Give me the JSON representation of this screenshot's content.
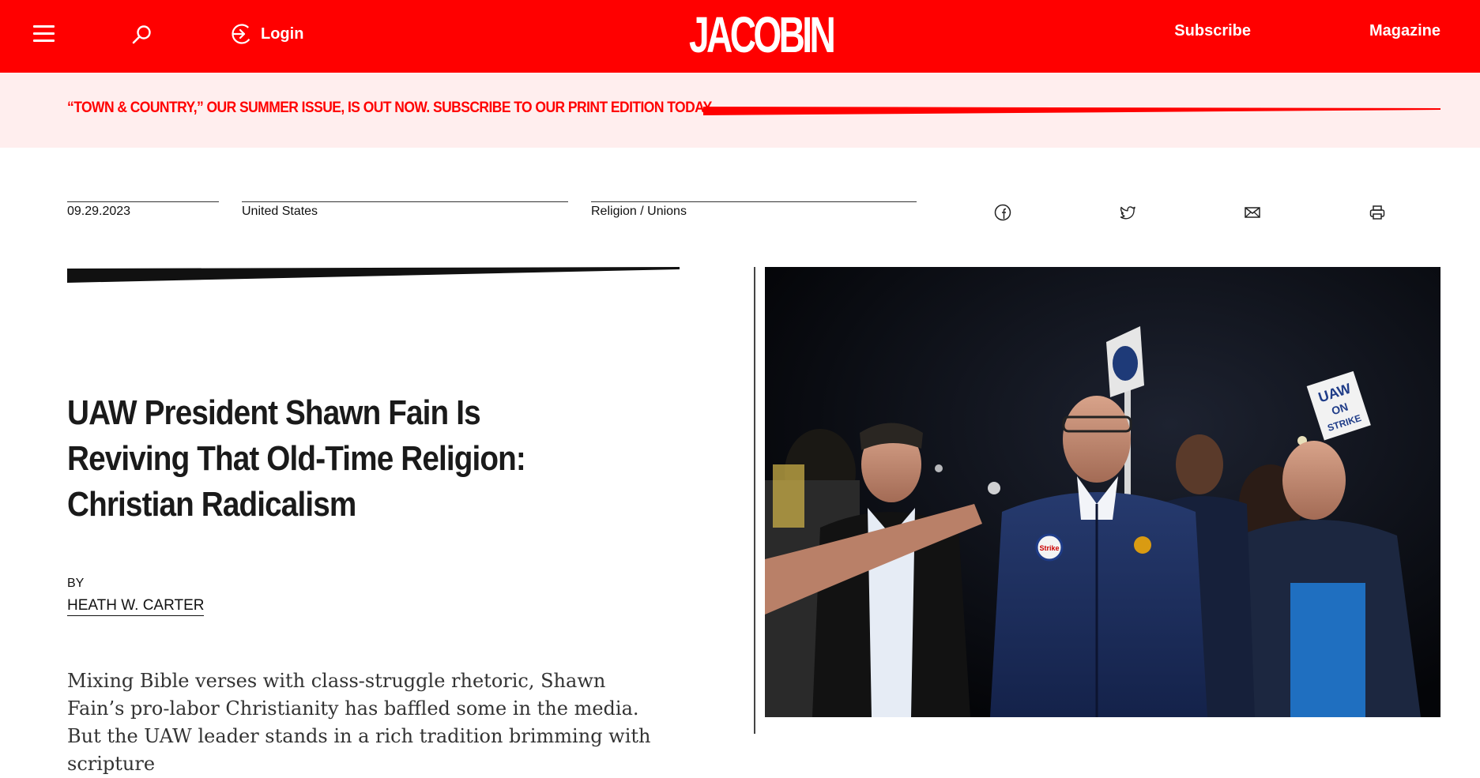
{
  "header": {
    "menu_icon": "hamburger-icon",
    "search_icon": "search-icon",
    "login_icon": "login-arrow-icon",
    "login_label": "Login",
    "logo": "JACOBIN",
    "subscribe_label": "Subscribe",
    "magazine_label": "Magazine",
    "brand_color": "#ff0000"
  },
  "promo": {
    "text": "“TOWN & COUNTRY,” OUR SUMMER ISSUE, IS OUT NOW. SUBSCRIBE TO OUR PRINT EDITION TODAY.",
    "background": "#ffeeee"
  },
  "meta": {
    "date": "09.29.2023",
    "region": "United States",
    "topics": "Religion / Unions"
  },
  "share": {
    "icons": [
      "facebook-icon",
      "twitter-icon",
      "email-icon",
      "print-icon"
    ]
  },
  "article": {
    "headline": "UAW President Shawn Fain Is Reviving That Old-Time Religion: Christian Radicalism",
    "byline_prefix": "BY",
    "author": "HEATH W. CARTER",
    "dek": "Mixing Bible verses with class-struggle rhetoric, Shawn Fain’s pro-labor Christianity has baffled some in the media. But the UAW leader stands in a rich tradition brimming with scripture"
  },
  "hero_image": {
    "sign_text_1": "UAW",
    "sign_text_2": "ON",
    "sign_text_3": "STRIKE",
    "button_text": "Strike"
  }
}
